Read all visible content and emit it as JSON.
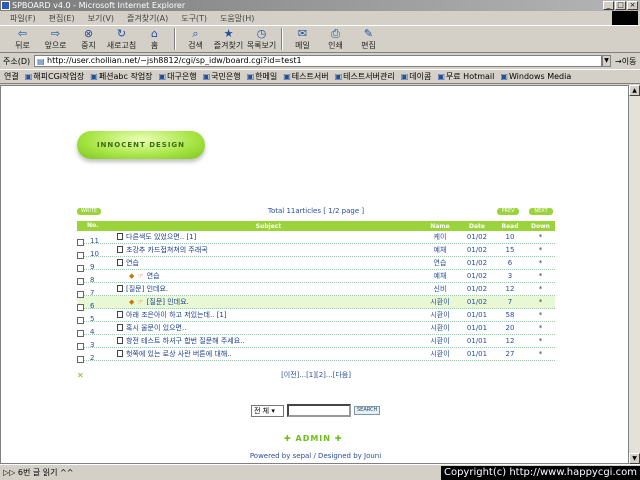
{
  "window": {
    "title": "SPBOARD v4.0 - Microsoft Internet Explorer"
  },
  "menu": [
    "파일(F)",
    "편집(E)",
    "보기(V)",
    "즐겨찾기(A)",
    "도구(T)",
    "도움말(H)"
  ],
  "toolbar": [
    {
      "label": "뒤로",
      "icon": "back-arrow-icon"
    },
    {
      "label": "앞으로",
      "icon": "forward-arrow-icon"
    },
    {
      "label": "중지",
      "icon": "stop-icon"
    },
    {
      "label": "새로고침",
      "icon": "refresh-icon"
    },
    {
      "label": "홈",
      "icon": "home-icon"
    },
    {
      "label": "검색",
      "icon": "search-icon"
    },
    {
      "label": "즐겨찾기",
      "icon": "favorites-icon"
    },
    {
      "label": "목록보기",
      "icon": "history-icon"
    },
    {
      "label": "메일",
      "icon": "mail-icon"
    },
    {
      "label": "인쇄",
      "icon": "print-icon"
    },
    {
      "label": "편집",
      "icon": "edit-icon"
    }
  ],
  "address": {
    "label": "주소(D)",
    "url": "http://user.chollian.net/~jsh8812/cgi/sp_idw/board.cgi?id=test1",
    "go_label": "이동"
  },
  "links": {
    "label": "연결",
    "items": [
      "해피CGI작업장",
      "페션abc 작업장",
      "대구은행",
      "국민은행",
      "한메일",
      "테스트서버",
      "테스트서버관리",
      "데이콤",
      "무료 Hotmail",
      "Windows Media"
    ]
  },
  "page": {
    "logo_text": "INNOCENT DESIGN",
    "write_label": "WRITE",
    "total_text": "Total 11articles [ 1/2 page ]",
    "prev_label": "PREV",
    "next_label": "NEXT",
    "columns": {
      "no": "No.",
      "subject": "Subject",
      "name": "Name",
      "date": "Date",
      "read": "Read",
      "down": "Down"
    },
    "rows": [
      {
        "no": "11",
        "subject": "다른색도 있었으면.. [1]",
        "reply": false,
        "name": "케이",
        "date": "01/02",
        "read": "10",
        "down": "*"
      },
      {
        "no": "10",
        "subject": "초강추 카드접쳐쳐의 주래곡",
        "reply": false,
        "name": "예채",
        "date": "01/02",
        "read": "15",
        "down": "*"
      },
      {
        "no": "9",
        "subject": "연습",
        "reply": false,
        "name": "연습",
        "date": "01/02",
        "read": "6",
        "down": "*"
      },
      {
        "no": "8",
        "subject": "연습",
        "reply": true,
        "name": "예채",
        "date": "01/02",
        "read": "3",
        "down": "*"
      },
      {
        "no": "7",
        "subject": "[질문] 인데요.",
        "reply": false,
        "name": "신비",
        "date": "01/02",
        "read": "12",
        "down": "*"
      },
      {
        "no": "6",
        "subject": "[질문] 인데요.",
        "reply": true,
        "name": "시환이",
        "date": "01/02",
        "read": "7",
        "down": "*",
        "highlight": true
      },
      {
        "no": "5",
        "subject": "아래 조은아이 하고 저있는데.. [1]",
        "reply": false,
        "name": "시환이",
        "date": "01/01",
        "read": "58",
        "down": "*"
      },
      {
        "no": "4",
        "subject": "혹시 울문이 있으면..",
        "reply": false,
        "name": "시환이",
        "date": "01/01",
        "read": "20",
        "down": "*"
      },
      {
        "no": "3",
        "subject": "항전 테스트 하셔구 합번 질문해 주세요..",
        "reply": false,
        "name": "시환이",
        "date": "01/01",
        "read": "12",
        "down": "*"
      },
      {
        "no": "2",
        "subject": "헛쪽에 있는 로상 사란 버튼에 대해..",
        "reply": false,
        "name": "시환이",
        "date": "01/01",
        "read": "27",
        "down": "*"
      }
    ],
    "pager_text": "[이전]...[1][2]...[다음]",
    "search_select": "전 체",
    "search_button": "SEARCH",
    "admin_label": "ADMIN",
    "powered_text": "Powered by sepal / Designed by Jouni"
  },
  "status": {
    "text": "▷▷ 6번 글 읽기 ^^",
    "copyright": "Copyright(c) http://www.happycgi.com"
  }
}
